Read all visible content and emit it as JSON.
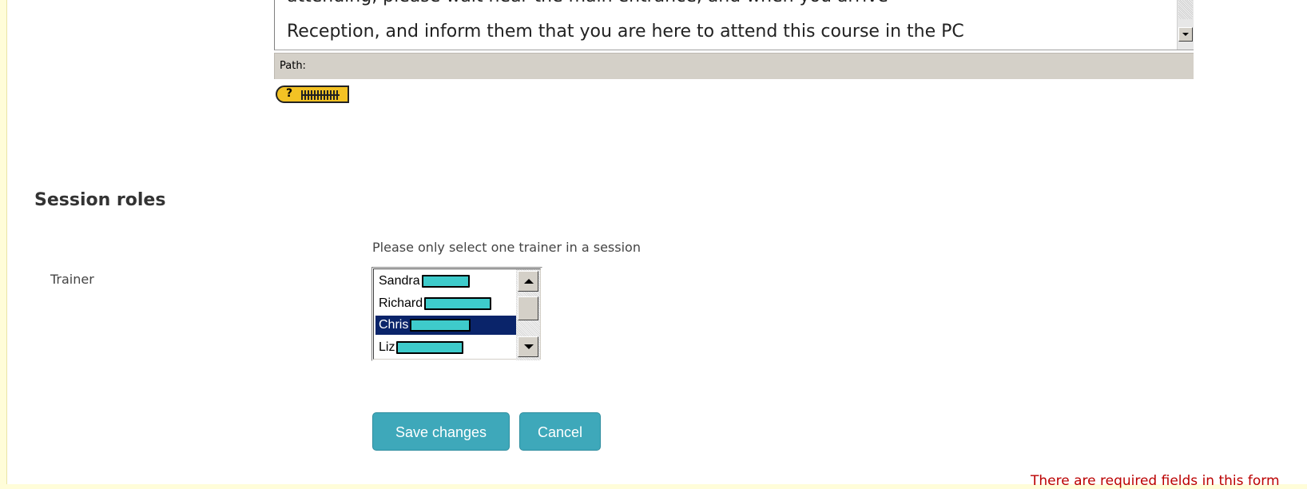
{
  "editor": {
    "line1": "attending, please wait near the main entrance, and when you arrive",
    "line2": "Reception, and inform them that you are here to attend this course in the PC"
  },
  "pathbar": {
    "label": "Path:"
  },
  "section": {
    "title": "Session roles"
  },
  "roles": {
    "hint": "Please only select one trainer in a session",
    "trainer_label": "Trainer",
    "options": [
      {
        "first": "Sandra",
        "selected": false
      },
      {
        "first": "Richard",
        "selected": false
      },
      {
        "first": "Chris",
        "selected": true
      },
      {
        "first": "Liz",
        "selected": false
      }
    ]
  },
  "buttons": {
    "save": "Save changes",
    "cancel": "Cancel"
  },
  "required_notice": "There are required fields in this form",
  "colors": {
    "page_bg": "#fffdd9",
    "button": "#3ea8ba",
    "selection": "#0a246a",
    "redaction": "#3ecbcb",
    "required": "#bb0000"
  }
}
